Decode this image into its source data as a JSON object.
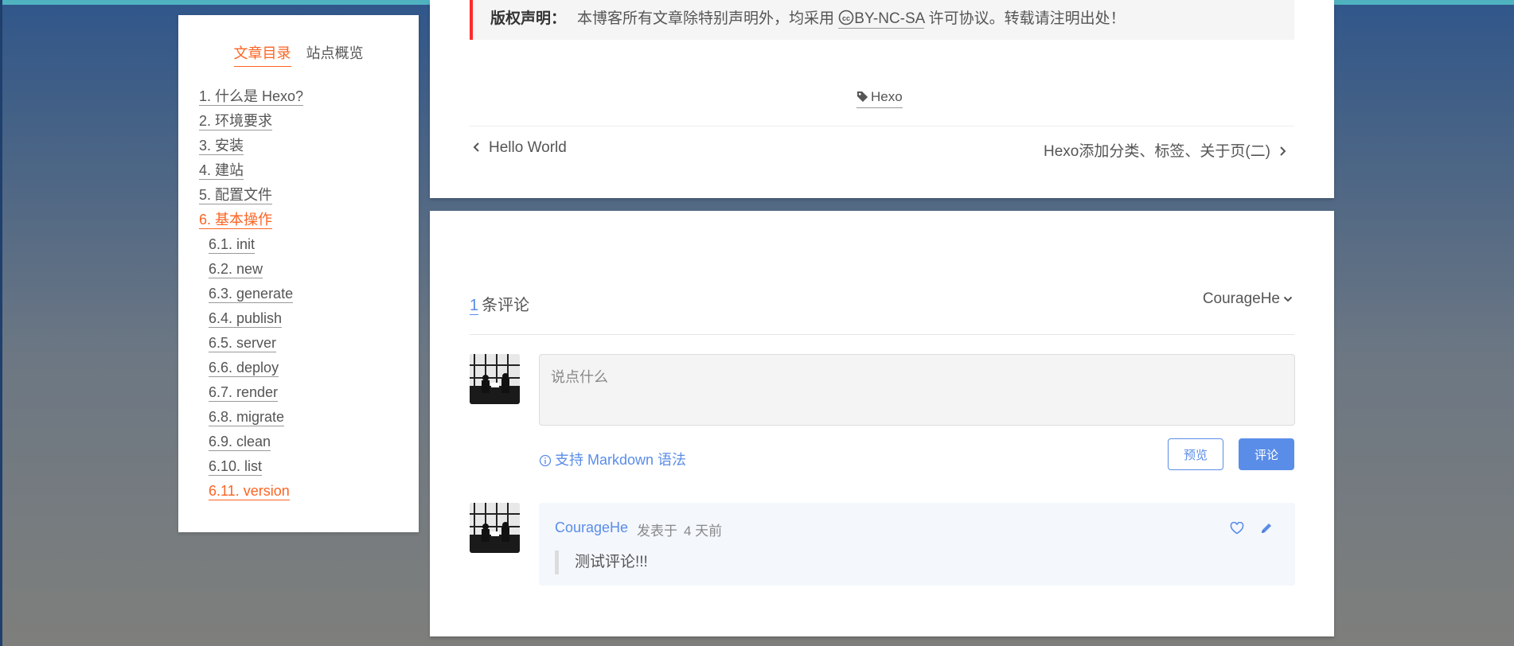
{
  "sidebar": {
    "tabs": [
      {
        "label": "文章目录",
        "active": true
      },
      {
        "label": "站点概览",
        "active": false
      }
    ],
    "toc": [
      {
        "label": "1. 什么是 Hexo?",
        "level": 1
      },
      {
        "label": "2. 环境要求",
        "level": 1
      },
      {
        "label": "3. 安装",
        "level": 1
      },
      {
        "label": "4. 建站",
        "level": 1
      },
      {
        "label": "5. 配置文件",
        "level": 1
      },
      {
        "label": "6. 基本操作",
        "level": 1,
        "active": true
      },
      {
        "label": "6.1. init",
        "level": 2
      },
      {
        "label": "6.2. new",
        "level": 2
      },
      {
        "label": "6.3. generate",
        "level": 2
      },
      {
        "label": "6.4. publish",
        "level": 2
      },
      {
        "label": "6.5. server",
        "level": 2
      },
      {
        "label": "6.6. deploy",
        "level": 2
      },
      {
        "label": "6.7. render",
        "level": 2
      },
      {
        "label": "6.8. migrate",
        "level": 2
      },
      {
        "label": "6.9. clean",
        "level": 2
      },
      {
        "label": "6.10. list",
        "level": 2
      },
      {
        "label": "6.11. version",
        "level": 2,
        "active": true
      }
    ]
  },
  "post": {
    "copyright_label": "版权声明：",
    "copyright_text_before": "本博客所有文章除特别声明外，均采用 ",
    "copyright_license": "BY-NC-SA",
    "copyright_text_after": " 许可协议。转载请注明出处！",
    "tag": "Hexo",
    "prev_post": "Hello World",
    "next_post": "Hexo添加分类、标签、关于页(二)"
  },
  "comments": {
    "count": "1",
    "count_label": "条评论",
    "current_user": "CourageHe",
    "placeholder": "说点什么",
    "markdown_hint": "支持 Markdown 语法",
    "preview_label": "预览",
    "submit_label": "评论",
    "items": [
      {
        "author": "CourageHe",
        "posted_label": "发表于",
        "time": "4 天前",
        "body": "测试评论!!!"
      }
    ]
  },
  "colors": {
    "accent": "#fc6423",
    "link": "#5a8de8",
    "copyright_bar": "#ff2a2a",
    "top_stripe": "#4fb3bf"
  },
  "icons": {
    "tag": "tag-icon",
    "prev": "chevron-left-icon",
    "next": "chevron-right-icon",
    "dropdown": "chevron-down-icon",
    "info": "info-icon",
    "like": "heart-icon",
    "edit": "pencil-icon",
    "cc": "creative-commons-icon"
  }
}
